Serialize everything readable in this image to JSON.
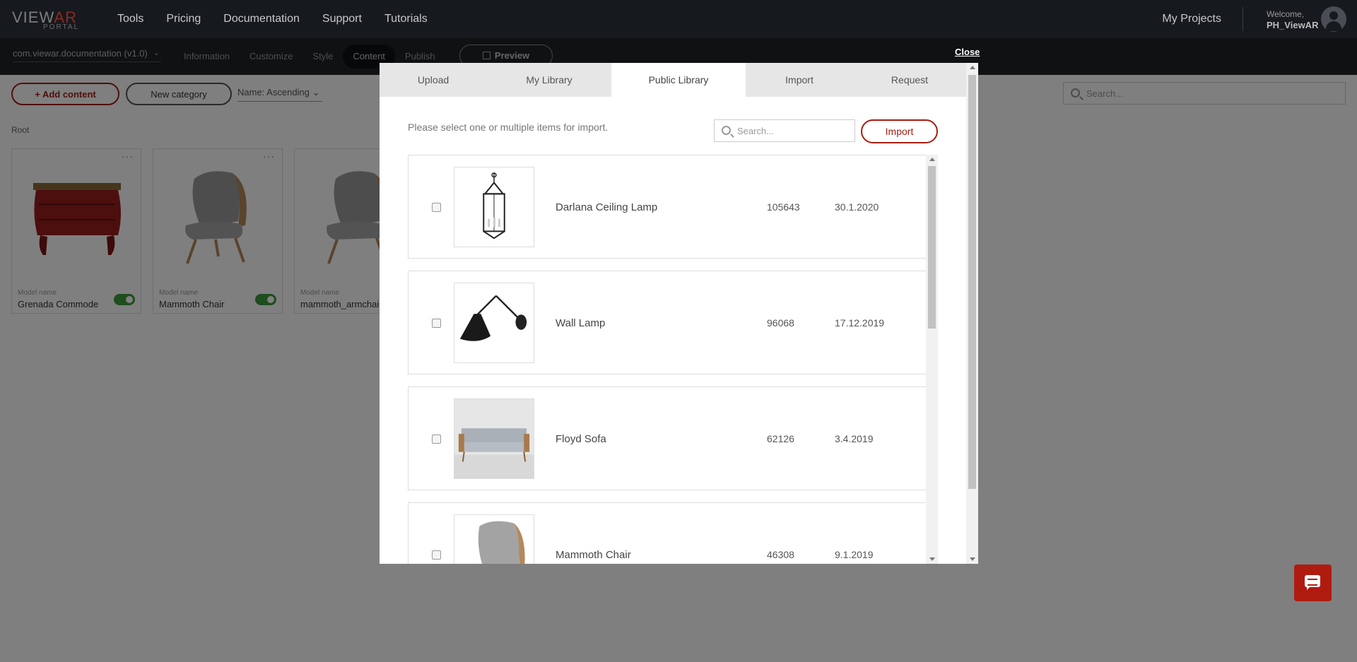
{
  "brand": {
    "logo_main_1": "VIEW",
    "logo_main_2": "AR",
    "logo_sub": "PORTAL"
  },
  "topnav": {
    "items": [
      "Tools",
      "Pricing",
      "Documentation",
      "Support",
      "Tutorials"
    ],
    "my_projects": "My Projects",
    "welcome_label": "Welcome,",
    "username": "PH_ViewAR"
  },
  "subnav": {
    "app_selector": "com.viewar.documentation (v1.0)",
    "tabs": [
      "Information",
      "Customize",
      "Style",
      "Content",
      "Publish"
    ],
    "active_tab": "Content",
    "preview": "Preview"
  },
  "toolbar": {
    "add_content": "+ Add content",
    "new_category": "New category",
    "sort": "Name: Ascending",
    "search_placeholder": "Search..."
  },
  "content": {
    "breadcrumb": "Root",
    "cards": [
      {
        "label": "Model name",
        "name": "Grenada Commode",
        "enabled": true
      },
      {
        "label": "Model name",
        "name": "Mammoth Chair",
        "enabled": true
      },
      {
        "label": "Model name",
        "name": "mammoth_armchair_",
        "enabled": true
      }
    ]
  },
  "modal": {
    "close": "Close",
    "tabs": [
      "Upload",
      "My Library",
      "Public Library",
      "Import",
      "Request"
    ],
    "active_tab": "Public Library",
    "instruction": "Please select one or multiple items for import.",
    "search_placeholder": "Search...",
    "import_button": "Import",
    "items": [
      {
        "name": "Darlana Ceiling Lamp",
        "id": "105643",
        "date": "30.1.2020",
        "thumb": "ceiling-lamp"
      },
      {
        "name": "Wall Lamp",
        "id": "96068",
        "date": "17.12.2019",
        "thumb": "wall-lamp"
      },
      {
        "name": "Floyd Sofa",
        "id": "62126",
        "date": "3.4.2019",
        "thumb": "sofa"
      },
      {
        "name": "Mammoth Chair",
        "id": "46308",
        "date": "9.1.2019",
        "thumb": "armchair"
      }
    ]
  },
  "colors": {
    "accent": "#a31e12",
    "topbar": "#16191d",
    "subbar": "#1f2327",
    "toggle_on": "#3c9a3c"
  }
}
